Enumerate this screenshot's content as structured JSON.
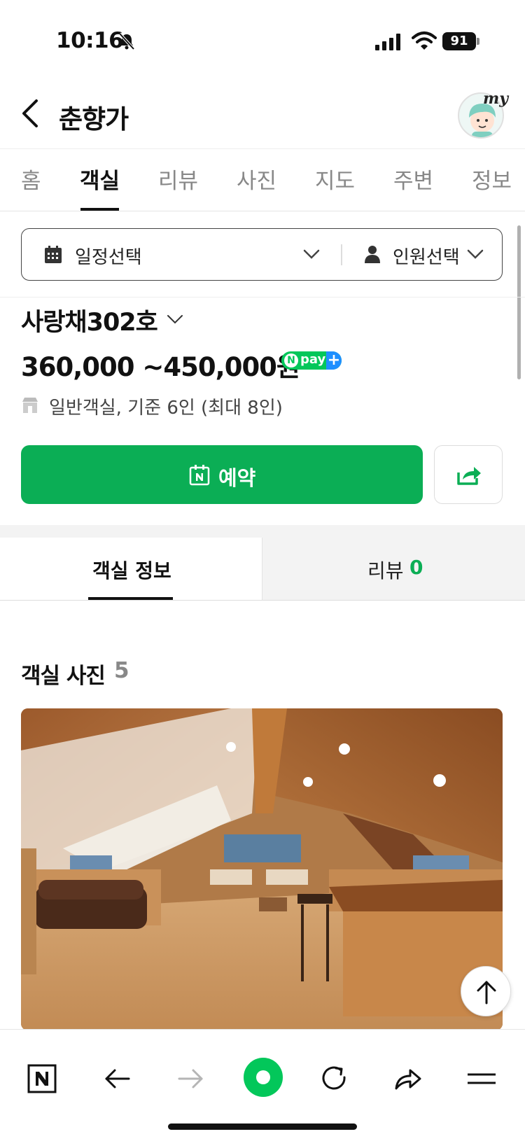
{
  "status_bar": {
    "time": "10:16",
    "battery": "91"
  },
  "header": {
    "title": "춘향가",
    "avatar_label": "my"
  },
  "tabs": [
    {
      "label": "홈",
      "active": false
    },
    {
      "label": "객실",
      "active": true
    },
    {
      "label": "리뷰",
      "active": false
    },
    {
      "label": "사진",
      "active": false
    },
    {
      "label": "지도",
      "active": false
    },
    {
      "label": "주변",
      "active": false
    },
    {
      "label": "정보",
      "active": false
    }
  ],
  "selector": {
    "date_label": "일정선택",
    "people_label": "인원선택"
  },
  "room": {
    "name": "사랑채302호",
    "price": "360,000 ~450,000원",
    "npay": {
      "n": "N",
      "text": "pay",
      "plus": "+"
    },
    "type": "일반객실, 기준 6인 (최대 8인)"
  },
  "actions": {
    "reserve_label": "예약"
  },
  "subtabs": {
    "info_label": "객실 정보",
    "review_label": "리뷰",
    "review_count": "0"
  },
  "photos": {
    "title": "객실 사진",
    "count": "5"
  },
  "colors": {
    "accent": "#0bae55",
    "npay_green": "#03c75a",
    "npay_blue": "#1e8fff"
  },
  "icons": {
    "status": [
      "bell-slash-icon",
      "signal-icon",
      "wifi-icon",
      "battery-icon"
    ],
    "bottom_bar": [
      "naver-n-icon",
      "arrow-left-icon",
      "arrow-right-icon",
      "green-dot-icon",
      "refresh-icon",
      "share-arrow-icon",
      "menu-icon"
    ]
  }
}
